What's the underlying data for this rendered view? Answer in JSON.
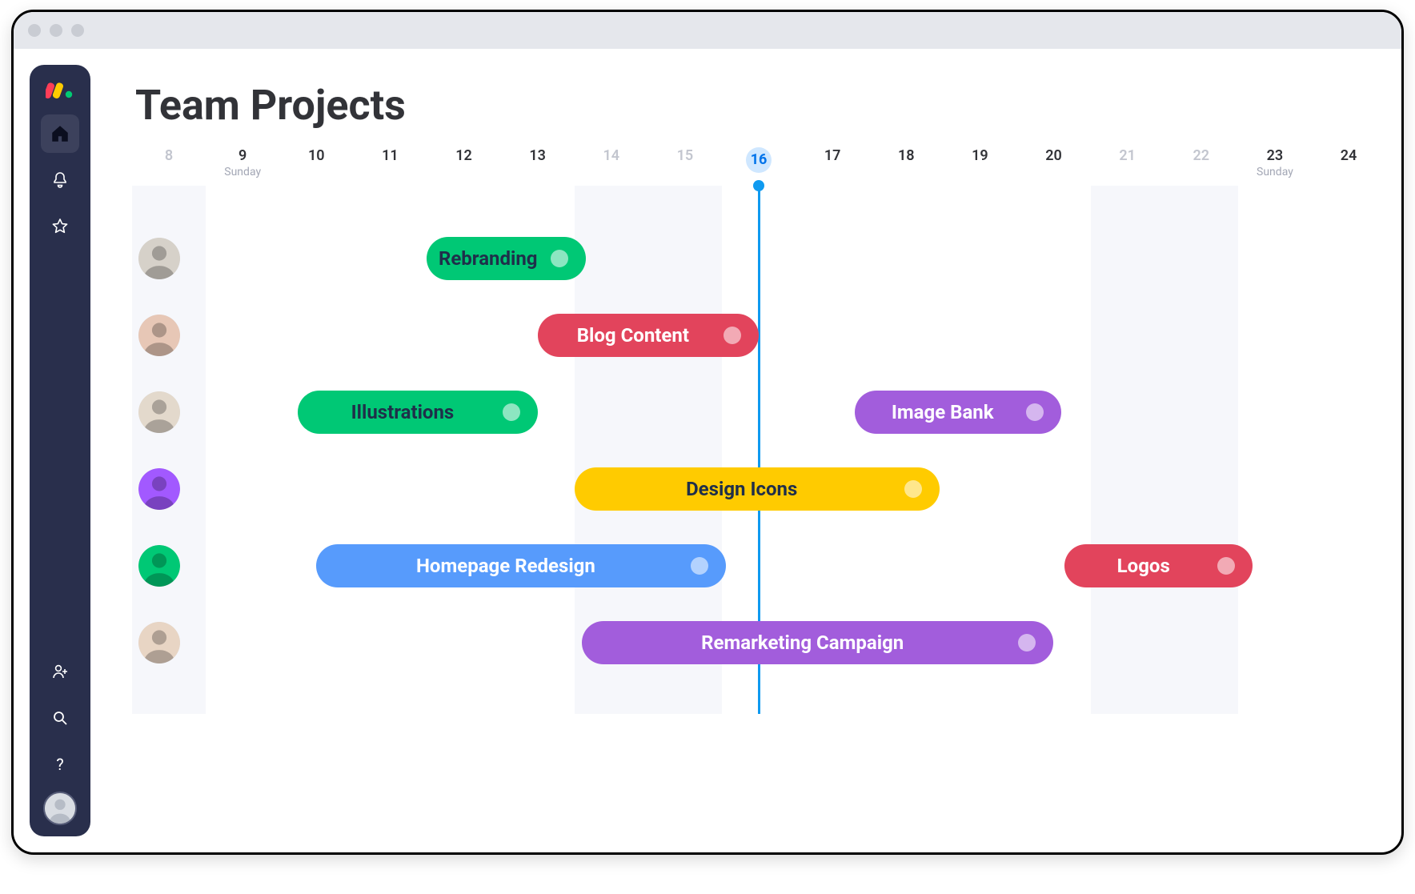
{
  "page": {
    "title": "Team Projects"
  },
  "dateRange": {
    "start": 8,
    "end": 24
  },
  "dates": [
    {
      "num": 8,
      "muted": true
    },
    {
      "num": 9,
      "day": "Sunday"
    },
    {
      "num": 10
    },
    {
      "num": 11
    },
    {
      "num": 12
    },
    {
      "num": 13
    },
    {
      "num": 14,
      "muted": true
    },
    {
      "num": 15,
      "muted": true
    },
    {
      "num": 16,
      "today": true
    },
    {
      "num": 17
    },
    {
      "num": 18
    },
    {
      "num": 19
    },
    {
      "num": 20
    },
    {
      "num": 21,
      "muted": true
    },
    {
      "num": 22,
      "muted": true
    },
    {
      "num": 23,
      "day": "Sunday"
    },
    {
      "num": 24
    }
  ],
  "todayIndex": 8,
  "rows": [
    {
      "avatarBg": "#d6d1c9"
    },
    {
      "avatarBg": "#e7c7b6"
    },
    {
      "avatarBg": "#e3d9cc"
    },
    {
      "avatarBg": "#a259ff"
    },
    {
      "avatarBg": "#00c875"
    },
    {
      "avatarBg": "#e8d5c4"
    }
  ],
  "tasks": [
    {
      "row": 0,
      "label": "Rebranding",
      "color": "#00c875",
      "textClass": "dark-text",
      "start": 12.0,
      "end": 14.15
    },
    {
      "row": 1,
      "label": "Blog Content",
      "color": "#e2445c",
      "textClass": "light-text",
      "start": 13.5,
      "end": 16.5
    },
    {
      "row": 2,
      "label": "Illustrations",
      "color": "#00c875",
      "textClass": "dark-text",
      "start": 10.25,
      "end": 13.5
    },
    {
      "row": 2,
      "label": "Image Bank",
      "color": "#a25ddc",
      "textClass": "light-text",
      "start": 17.8,
      "end": 20.6
    },
    {
      "row": 3,
      "label": "Design Icons",
      "color": "#ffcb00",
      "textClass": "dark-text",
      "start": 14.0,
      "end": 18.95
    },
    {
      "row": 4,
      "label": "Homepage Redesign",
      "color": "#579bfc",
      "textClass": "light-text",
      "start": 10.5,
      "end": 16.05
    },
    {
      "row": 4,
      "label": "Logos",
      "color": "#e2445c",
      "textClass": "light-text",
      "start": 20.65,
      "end": 23.2
    },
    {
      "row": 5,
      "label": "Remarketing Campaign",
      "color": "#a25ddc",
      "textClass": "light-text",
      "start": 14.1,
      "end": 20.5
    }
  ],
  "chart_data": {
    "type": "gantt",
    "title": "Team Projects",
    "x_axis": {
      "unit": "day-of-month",
      "start": 8,
      "end": 24,
      "today": 16
    },
    "rows": 6,
    "series": [
      {
        "row": 0,
        "name": "Rebranding",
        "start": 12.0,
        "end": 14.2,
        "color": "#00c875"
      },
      {
        "row": 1,
        "name": "Blog Content",
        "start": 13.5,
        "end": 16.5,
        "color": "#e2445c"
      },
      {
        "row": 2,
        "name": "Illustrations",
        "start": 10.3,
        "end": 13.5,
        "color": "#00c875"
      },
      {
        "row": 2,
        "name": "Image Bank",
        "start": 17.8,
        "end": 20.6,
        "color": "#a25ddc"
      },
      {
        "row": 3,
        "name": "Design Icons",
        "start": 14.0,
        "end": 19.0,
        "color": "#ffcb00"
      },
      {
        "row": 4,
        "name": "Homepage Redesign",
        "start": 10.5,
        "end": 16.1,
        "color": "#579bfc"
      },
      {
        "row": 4,
        "name": "Logos",
        "start": 20.7,
        "end": 23.2,
        "color": "#e2445c"
      },
      {
        "row": 5,
        "name": "Remarketing Campaign",
        "start": 14.1,
        "end": 20.5,
        "color": "#a25ddc"
      }
    ]
  }
}
